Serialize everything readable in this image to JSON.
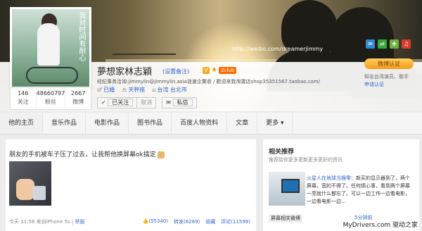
{
  "profile": {
    "name": "夢想家林志穎",
    "note_link": "(设置备注)",
    "v_badge": "V",
    "club_badge": "Zclub",
    "description": "经纪事务洽询:jimmylin@jimmylin.asia谜速企業收 / 歡迎來我淘寶店shop35351567.taobao.com/",
    "tags": [
      {
        "icon": "mars-icon",
        "label": "已婚"
      },
      {
        "icon": "zodiac-icon",
        "label": "天秤座"
      },
      {
        "icon": "location-icon",
        "label": "台湾 台北市"
      }
    ],
    "follow": {
      "following": "已关注",
      "cancel": "取消",
      "message": "私信"
    },
    "avatar_text": "我对时间有耐心",
    "stats": [
      {
        "value": "146",
        "label": "关注"
      },
      {
        "value": "48660797",
        "label": "粉丝"
      },
      {
        "value": "2667",
        "label": "微博"
      }
    ]
  },
  "cover": {
    "url": "http://weibo.com/dreamerjimmy",
    "share_icons": [
      "sina-icon",
      "share-icon",
      "green-icon",
      "red-icon"
    ]
  },
  "auth": {
    "badge": "微博认证",
    "desc": "知名台湾演员、歌手",
    "apply": "申请认证"
  },
  "nav": {
    "tabs": [
      "他的主页",
      "音乐作品",
      "电影作品",
      "图书作品",
      "百度人物资料",
      "文章",
      "更多 ▾"
    ]
  },
  "feed": {
    "text": "朋友的手机被车子压了过去，让我帮他换屏幕ok搞定",
    "time": "今天 11:56",
    "source_prefix": "来自",
    "source": "iPhone 5s",
    "report": "举报",
    "actions": {
      "like": "(55340)",
      "repost": "转发(6289)",
      "collect": "收藏",
      "comment": "评论(11599)"
    }
  },
  "recommend": {
    "title": "相关推荐",
    "subtitle": "推荐给你更多更新更多更好的资讯",
    "user": "火星人在地球当猴零",
    "post": "：新买的显示器到了，两个屏幕，宽的不得了。任何烦心事，看到两个屏幕一亮就什么都忘了。可以一边工作一边看电影，一边看电影一边…",
    "thumb_label": "屏幕相关微博",
    "time": "5分钟前"
  },
  "watermark": "MyDrivers.com 驱动之家"
}
